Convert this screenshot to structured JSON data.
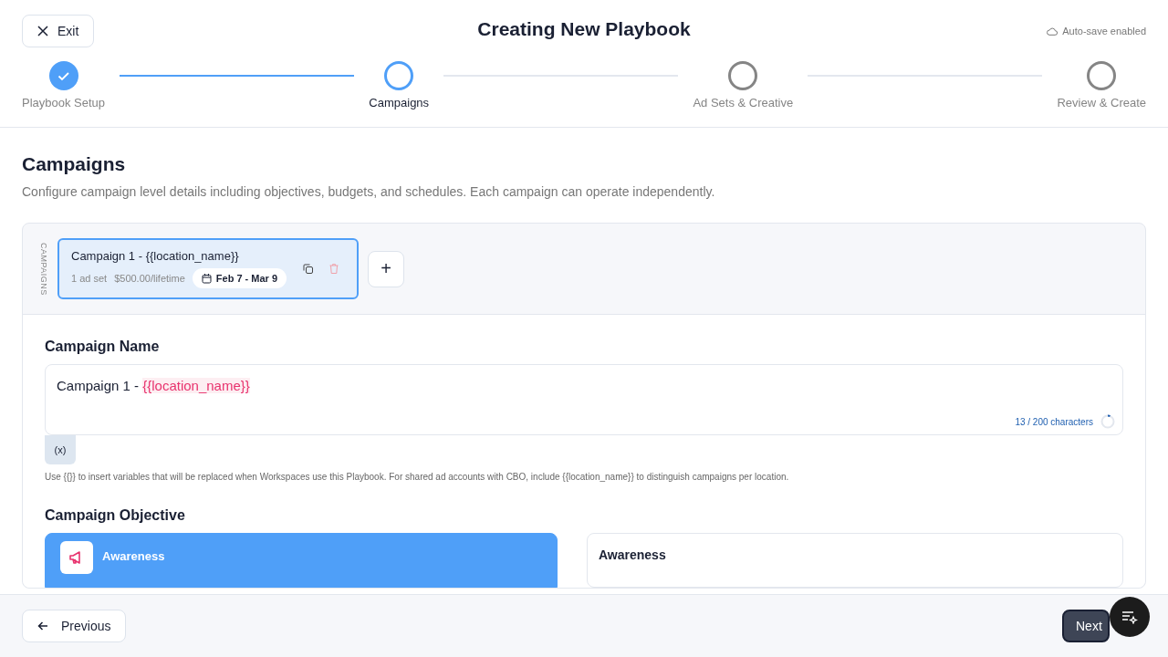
{
  "header": {
    "exit_label": "Exit",
    "title": "Creating New Playbook",
    "autosave": "Auto-save enabled"
  },
  "steps": [
    {
      "label": "Playbook Setup",
      "done": true,
      "selected": false
    },
    {
      "label": "Campaigns",
      "done": false,
      "selected": true
    },
    {
      "label": "Ad Sets & Creative",
      "done": false,
      "selected": false
    },
    {
      "label": "Review & Create",
      "done": false,
      "selected": false
    }
  ],
  "section": {
    "title": "Campaigns",
    "description": "Configure campaign level details including objectives, budgets, and schedules. Each campaign can operate independently."
  },
  "campaign_strip": {
    "label": "CAMPAIGNS",
    "add_label": "+",
    "campaigns": [
      {
        "name": "Campaign 1 - {{location_name}}",
        "ad_sets": "1 ad set",
        "budget": "$500.00/lifetime",
        "dates": "Feb 7 - Mar 9",
        "selected": true
      }
    ]
  },
  "campaign_name": {
    "label": "Campaign Name",
    "value": [
      {
        "kind": "plain",
        "text": "Campaign 1 - "
      },
      {
        "kind": "variable",
        "text": "{{location_name}}"
      }
    ],
    "counter": "13 / 200 characters",
    "variable_button": "(x)",
    "help": "Use {{}} to insert variables that will be replaced when Workspaces use this Playbook. For shared ad accounts with CBO, include {{location_name}} to distinguish campaigns per location."
  },
  "objective": {
    "label": "Campaign Objective",
    "options": [
      {
        "label": "Awareness",
        "selected": true
      }
    ],
    "detail_title": "Awareness"
  },
  "footer": {
    "previous_label": "Previous",
    "next_label": "Next"
  }
}
